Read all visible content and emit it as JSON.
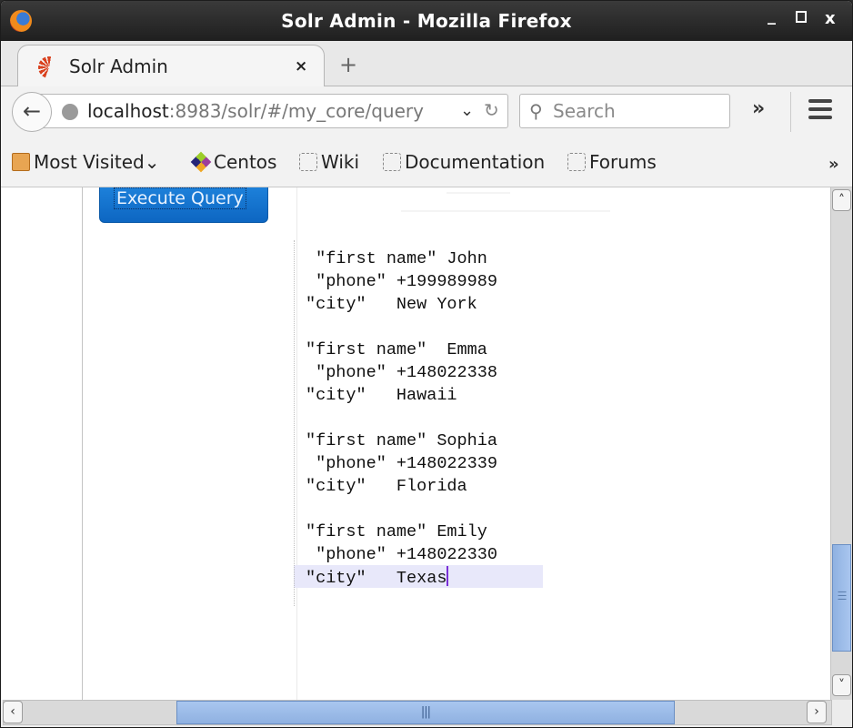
{
  "window": {
    "title": "Solr Admin - Mozilla Firefox",
    "controls": {
      "minimize": "_",
      "close": "x"
    }
  },
  "tabs": [
    {
      "label": "Solr Admin",
      "icon": "solr-icon",
      "close": "×"
    }
  ],
  "new_tab": "+",
  "navbar": {
    "back": "←",
    "url_host": "localhost",
    "url_rest": ":8983/solr/#/my_core/query",
    "dropdown": "⌄",
    "reload": "↻",
    "search_icon": "🔍",
    "search_placeholder": "Search",
    "overflow": "»"
  },
  "bookmarks": [
    {
      "label": "Most Visited",
      "icon": "folder-icon",
      "has_dropdown": true,
      "dropdown": "⌄"
    },
    {
      "label": "Centos",
      "icon": "centos-icon"
    },
    {
      "label": "Wiki",
      "icon": "bookmark-icon"
    },
    {
      "label": "Documentation",
      "icon": "bookmark-icon"
    },
    {
      "label": "Forums",
      "icon": "bookmark-icon"
    }
  ],
  "bookmarks_overflow": "»",
  "query": {
    "execute_label": "Execute Query"
  },
  "editor": {
    "lines": [
      " \"first name\" John",
      " \"phone\" +199989989",
      "\"city\"   New York",
      "",
      "\"first name\"  Emma",
      " \"phone\" +148022338",
      "\"city\"   Hawaii",
      "",
      "\"first name\" Sophia",
      " \"phone\" +148022339",
      "\"city\"   Florida",
      "",
      "\"first name\" Emily",
      " \"phone\" +148022330",
      "\"city\"   Texas"
    ],
    "records": [
      {
        "first_name": "John",
        "phone": "+199989989",
        "city": "New York"
      },
      {
        "first_name": "Emma",
        "phone": "+148022338",
        "city": "Hawaii"
      },
      {
        "first_name": "Sophia",
        "phone": "+148022339",
        "city": "Florida"
      },
      {
        "first_name": "Emily",
        "phone": "+148022330",
        "city": "Texas"
      }
    ],
    "active_line": 15
  },
  "scrollbars": {
    "vertical": {
      "up": "˄",
      "down": "˅",
      "position_fraction": 0.85
    },
    "horizontal": {
      "left": "‹",
      "right": "›",
      "grip": "|||",
      "position_fraction": 0.25
    }
  },
  "colors": {
    "execute_button": "#1576d1",
    "scroll_thumb": "#9dbde9",
    "line_highlight": "#e8e8fa",
    "cursor": "#7a2fd6"
  }
}
